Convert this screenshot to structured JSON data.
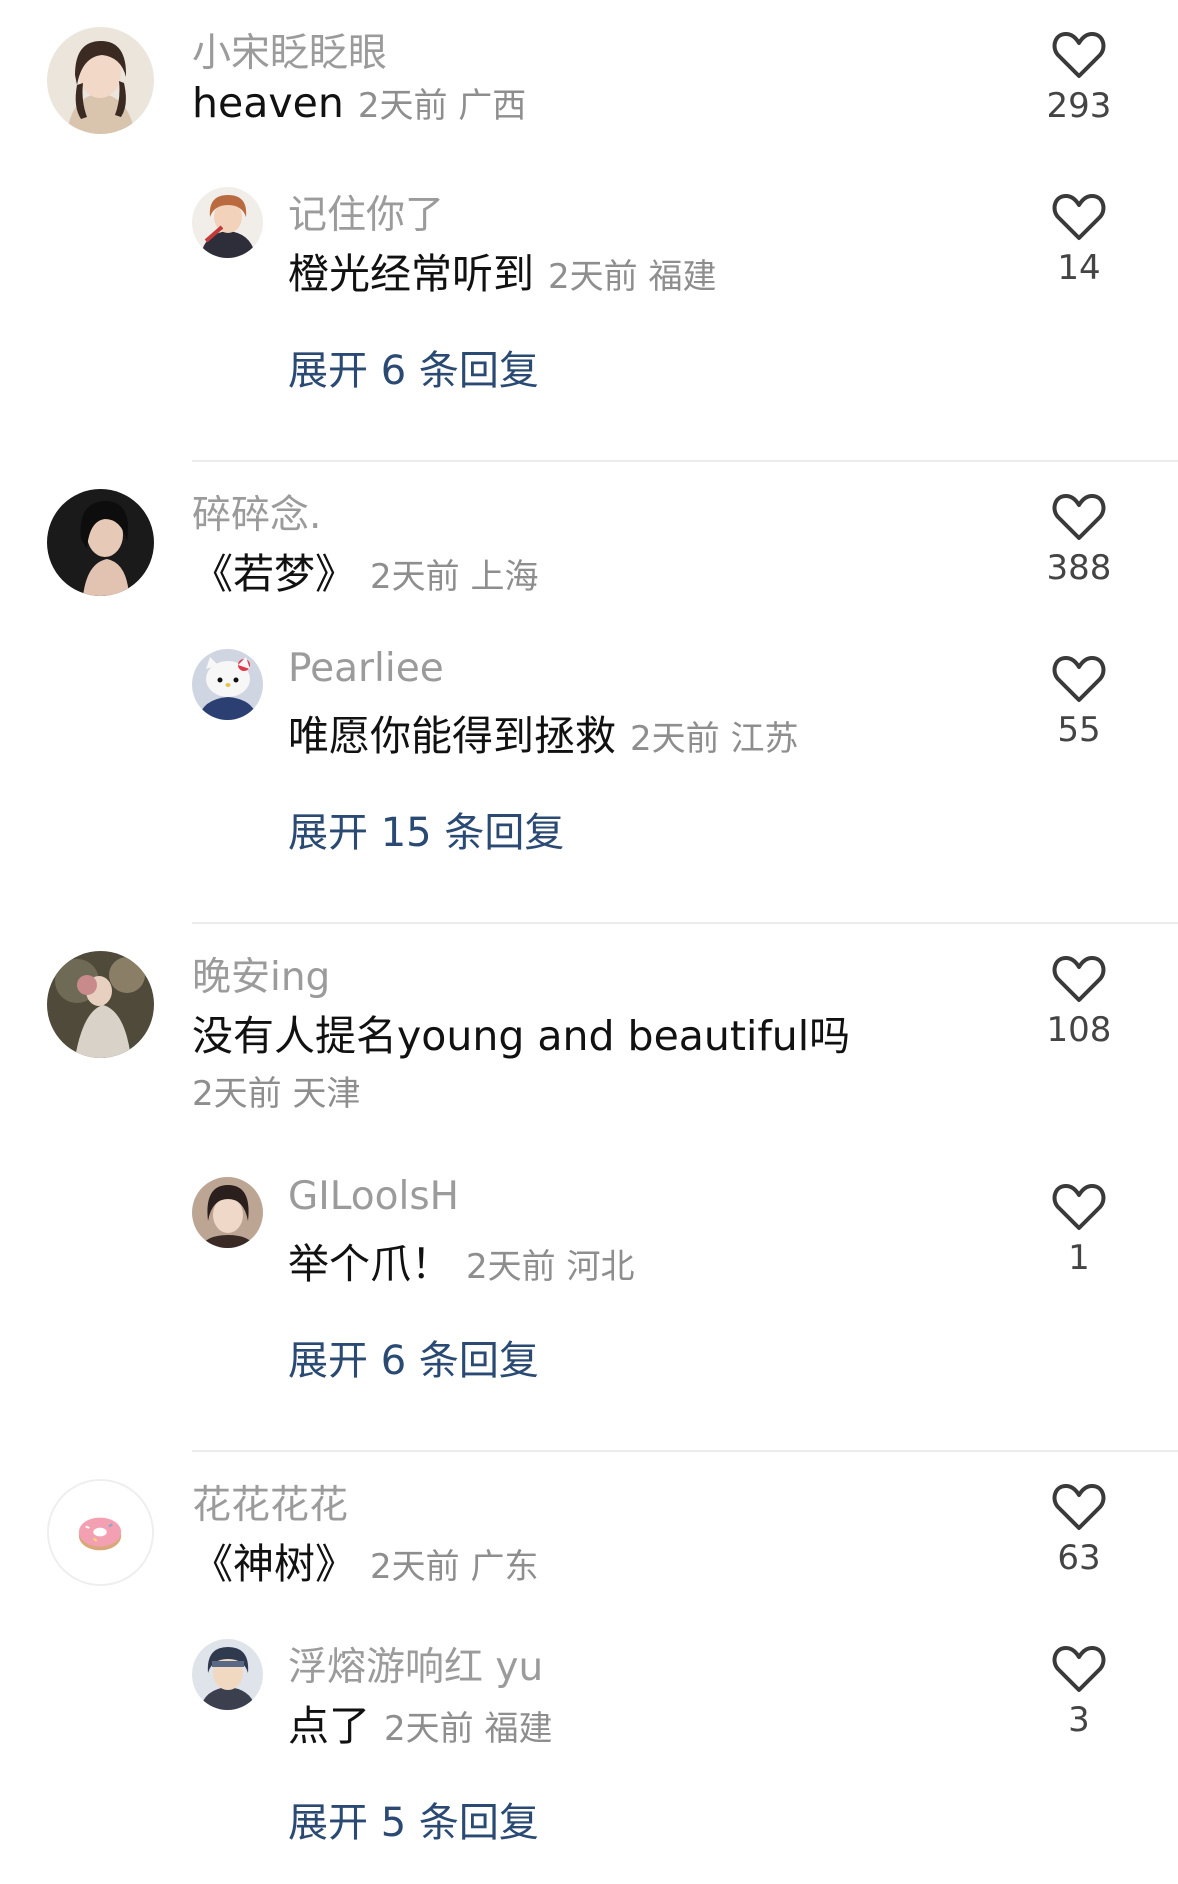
{
  "threads": [
    {
      "comment": {
        "user": "小宋眨眨眼",
        "text": "heaven",
        "meta": "2天前 广西",
        "likes": "293",
        "avatar_icon": "user-avatar-photo",
        "avatar_colors": [
          "#e9e1d6",
          "#3a2a22"
        ]
      },
      "reply": {
        "user": "记住你了",
        "text": "橙光经常听到",
        "meta": "2天前 福建",
        "likes": "14",
        "avatar_icon": "user-avatar-anime",
        "avatar_colors": [
          "#b96a3f",
          "#2e2e3a"
        ]
      },
      "expand_label": "展开 6 条回复"
    },
    {
      "comment": {
        "user": "碎碎念.",
        "text": "《若梦》",
        "meta": "2天前 上海",
        "likes": "388",
        "avatar_icon": "user-avatar-photo",
        "avatar_colors": [
          "#1a1a1a",
          "#e7c9b8"
        ]
      },
      "reply": {
        "user": "Pearliee",
        "text": "唯愿你能得到拯救",
        "meta": "2天前 江苏",
        "likes": "55",
        "avatar_icon": "user-avatar-hellokitty",
        "avatar_colors": [
          "#f3f3f3",
          "#2b3f73"
        ]
      },
      "expand_label": "展开 15 条回复"
    },
    {
      "comment": {
        "user": "晚安ing",
        "text": "没有人提名young and beautiful吗",
        "meta": "2天前 天津",
        "likes": "108",
        "avatar_icon": "user-avatar-photo",
        "avatar_colors": [
          "#6f6a55",
          "#d8d2c8"
        ]
      },
      "reply": {
        "user": "GILoolsH",
        "text": "举个爪！",
        "meta": "2天前 河北",
        "likes": "1",
        "avatar_icon": "user-avatar-photo",
        "avatar_colors": [
          "#bda594",
          "#2a1f1c"
        ]
      },
      "expand_label": "展开 6 条回复"
    },
    {
      "comment": {
        "user": "花花花花",
        "text": "《神树》",
        "meta": "2天前 广东",
        "likes": "63",
        "avatar_icon": "donut-icon",
        "avatar_colors": [
          "#ffffff",
          "#f3a0b3"
        ]
      },
      "reply": {
        "user": "浮熔游响红 yu",
        "text": "点了",
        "meta": "2天前 福建",
        "likes": "3",
        "avatar_icon": "user-avatar-anime",
        "avatar_colors": [
          "#2f3a4f",
          "#f0d9c0"
        ]
      },
      "expand_label": "展开 5 条回复"
    }
  ]
}
